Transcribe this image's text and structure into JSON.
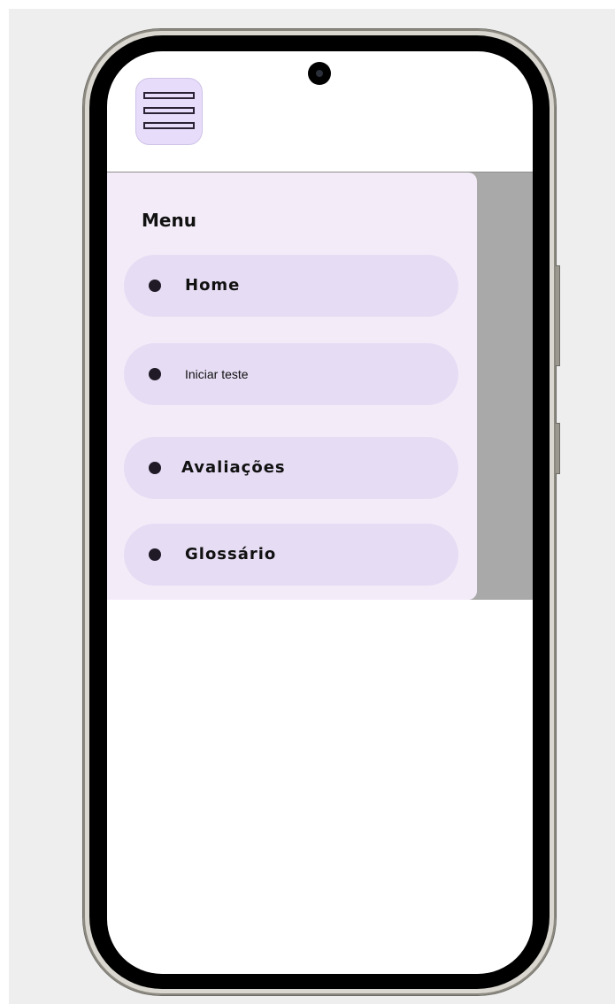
{
  "drawer": {
    "title": "Menu",
    "items": [
      {
        "label": "Home",
        "icon": "bullet-icon"
      },
      {
        "label": "Iniciar teste",
        "icon": "bullet-icon"
      },
      {
        "label": "Avaliações",
        "icon": "bullet-icon"
      },
      {
        "label": "Glossário",
        "icon": "bullet-icon"
      }
    ]
  },
  "app_bar": {
    "menu_icon": "hamburger-menu-icon"
  },
  "colors": {
    "accent": "#e6dcf4",
    "drawer_background": "#f3ecf8",
    "scrim": "#a9a9a9",
    "menu_button": "#e7dcfa"
  }
}
